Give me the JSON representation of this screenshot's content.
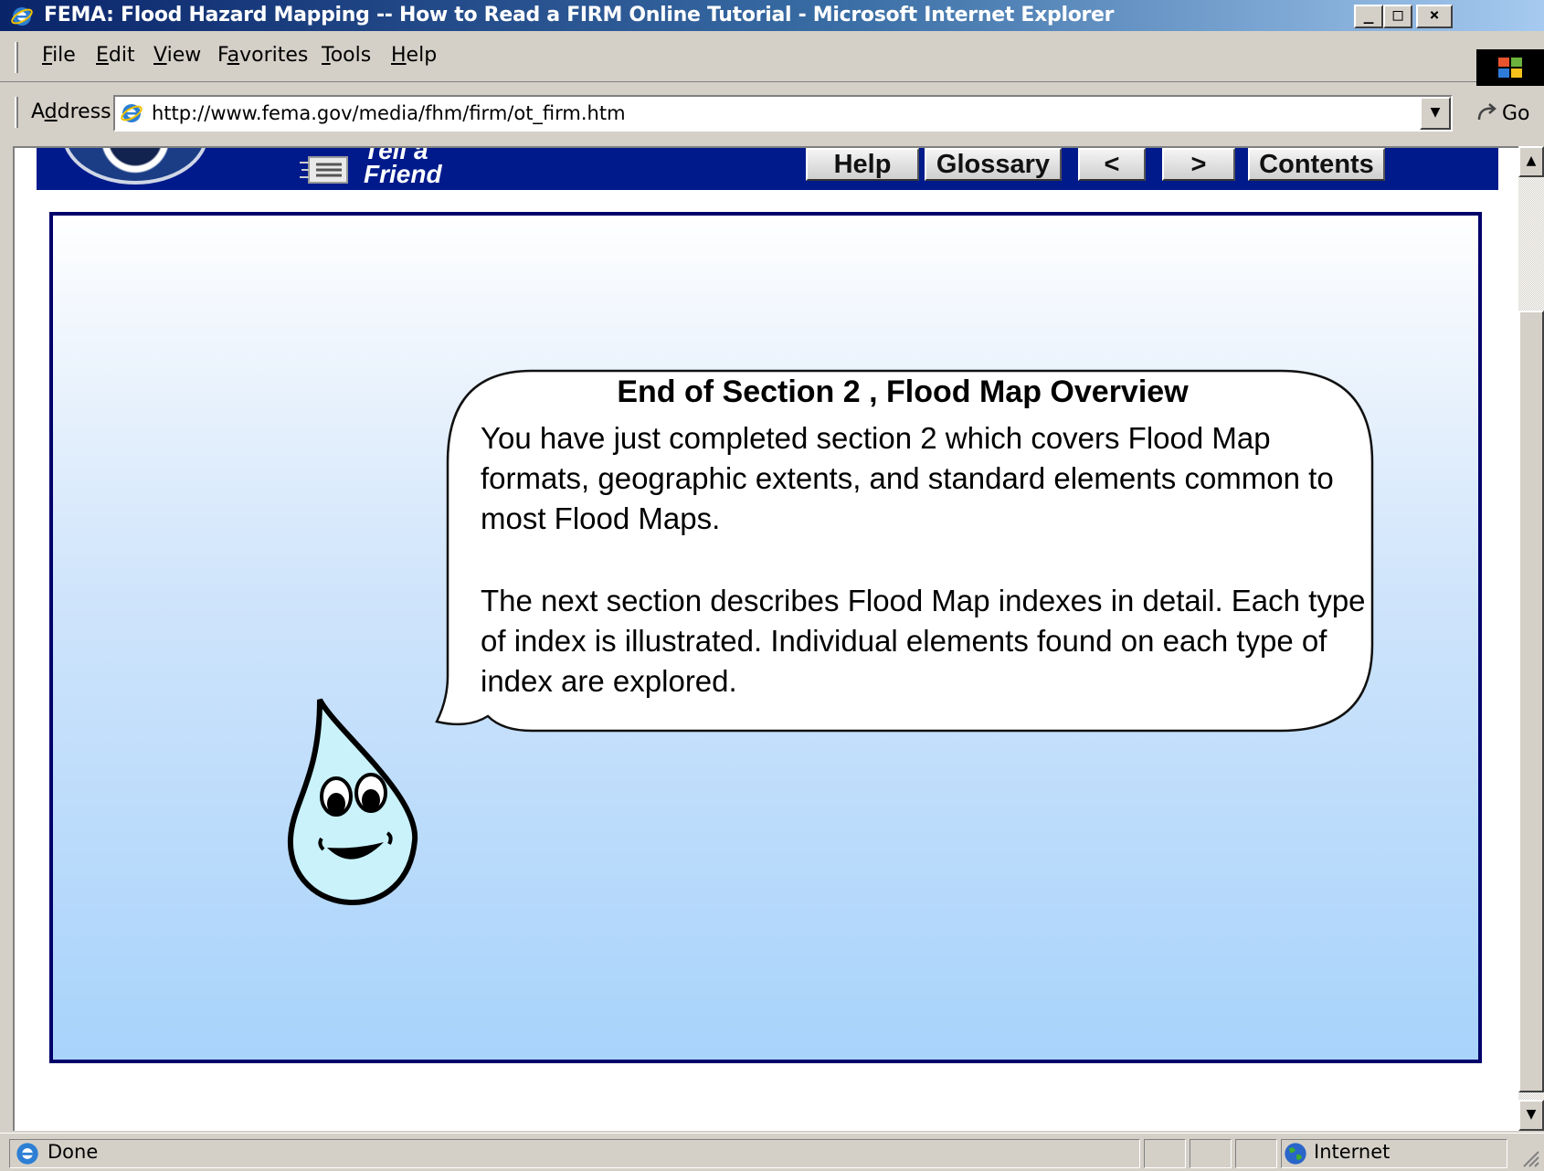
{
  "window": {
    "title": "FEMA: Flood Hazard Mapping -- How to Read a FIRM Online Tutorial - Microsoft Internet Explorer",
    "controls": {
      "minimize": "_",
      "maximize": "□",
      "close": "×"
    }
  },
  "menu": {
    "items": [
      {
        "key": "F",
        "rest": "ile"
      },
      {
        "key": "E",
        "rest": "dit"
      },
      {
        "key": "V",
        "rest": "iew"
      },
      {
        "pre": "F",
        "key": "a",
        "rest": "vorites"
      },
      {
        "key": "T",
        "rest": "ools"
      },
      {
        "key": "H",
        "rest": "elp"
      }
    ]
  },
  "address": {
    "label_pre": "A",
    "label_key": "d",
    "label_rest": "dress",
    "url": "http://www.fema.gov/media/fhm/firm/ot_firm.htm",
    "go_label": "Go"
  },
  "header": {
    "tell_friend": "Tell a Friend",
    "nav": {
      "help": "Help",
      "glossary": "Glossary",
      "prev": "<",
      "next": ">",
      "contents": "Contents"
    }
  },
  "lesson": {
    "title": "End of Section 2 , Flood Map Overview",
    "paragraph_1": "You have just completed section 2 which covers Flood Map formats, geographic extents, and standard elements common to most Flood Maps.",
    "paragraph_2": "The next section describes Flood Map indexes in detail. Each type of index is illustrated. Individual elements found on each type of index are explored."
  },
  "status": {
    "text": "Done",
    "zone": "Internet"
  },
  "colors": {
    "header_blue": "#001a8c",
    "frame_border": "#00006b",
    "drop_fill": "#c9f2fb"
  }
}
